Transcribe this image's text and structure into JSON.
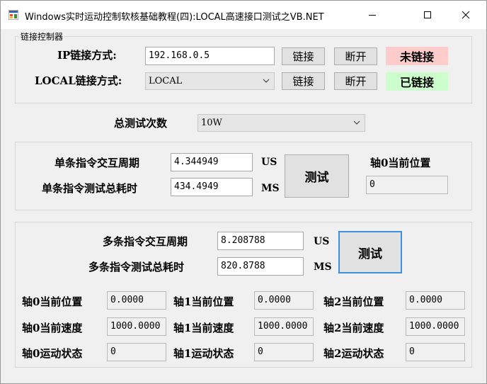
{
  "window": {
    "title": "Windows实时运动控制软核基础教程(四):LOCAL高速接口测试之VB.NET",
    "controls": [
      "minimize-icon",
      "maximize-icon",
      "close-icon"
    ]
  },
  "link_group": {
    "label": "链接控制器",
    "ip_label": "IP链接方式:",
    "ip_value": "192.168.0.5",
    "local_label": "LOCAL链接方式:",
    "local_value": "LOCAL",
    "connect_label": "链接",
    "disconnect_label": "断开",
    "status_unlinked": "未链接",
    "status_linked": "已链接",
    "status_unlinked_color": "#ffcccc",
    "status_linked_color": "#ccffcc"
  },
  "total_tests": {
    "label": "总测试次数",
    "value": "10W"
  },
  "single_group": {
    "cycle_label": "单条指令交互周期",
    "cycle_value": "4.344949",
    "cycle_unit": "US",
    "total_label": "单条指令测试总耗时",
    "total_value": "434.4949",
    "total_unit": "MS",
    "test_button": "测试",
    "axis_pos_label": "轴0当前位置",
    "axis_pos_value": "0"
  },
  "multi_group": {
    "cycle_label": "多条指令交互周期",
    "cycle_value": "8.208788",
    "cycle_unit": "US",
    "total_label": "多条指令测试总耗时",
    "total_value": "820.8788",
    "total_unit": "MS",
    "test_button": "测试",
    "axes": [
      {
        "pos_label": "轴0当前位置",
        "pos_value": "0.0000",
        "speed_label": "轴0当前速度",
        "speed_value": "1000.0000",
        "state_label": "轴0运动状态",
        "state_value": "0"
      },
      {
        "pos_label": "轴1当前位置",
        "pos_value": "0.0000",
        "speed_label": "轴1当前速度",
        "speed_value": "1000.0000",
        "state_label": "轴1运动状态",
        "state_value": "0"
      },
      {
        "pos_label": "轴2当前位置",
        "pos_value": "0.0000",
        "speed_label": "轴2当前速度",
        "speed_value": "1000.0000",
        "state_label": "轴2运动状态",
        "state_value": "0"
      }
    ]
  }
}
